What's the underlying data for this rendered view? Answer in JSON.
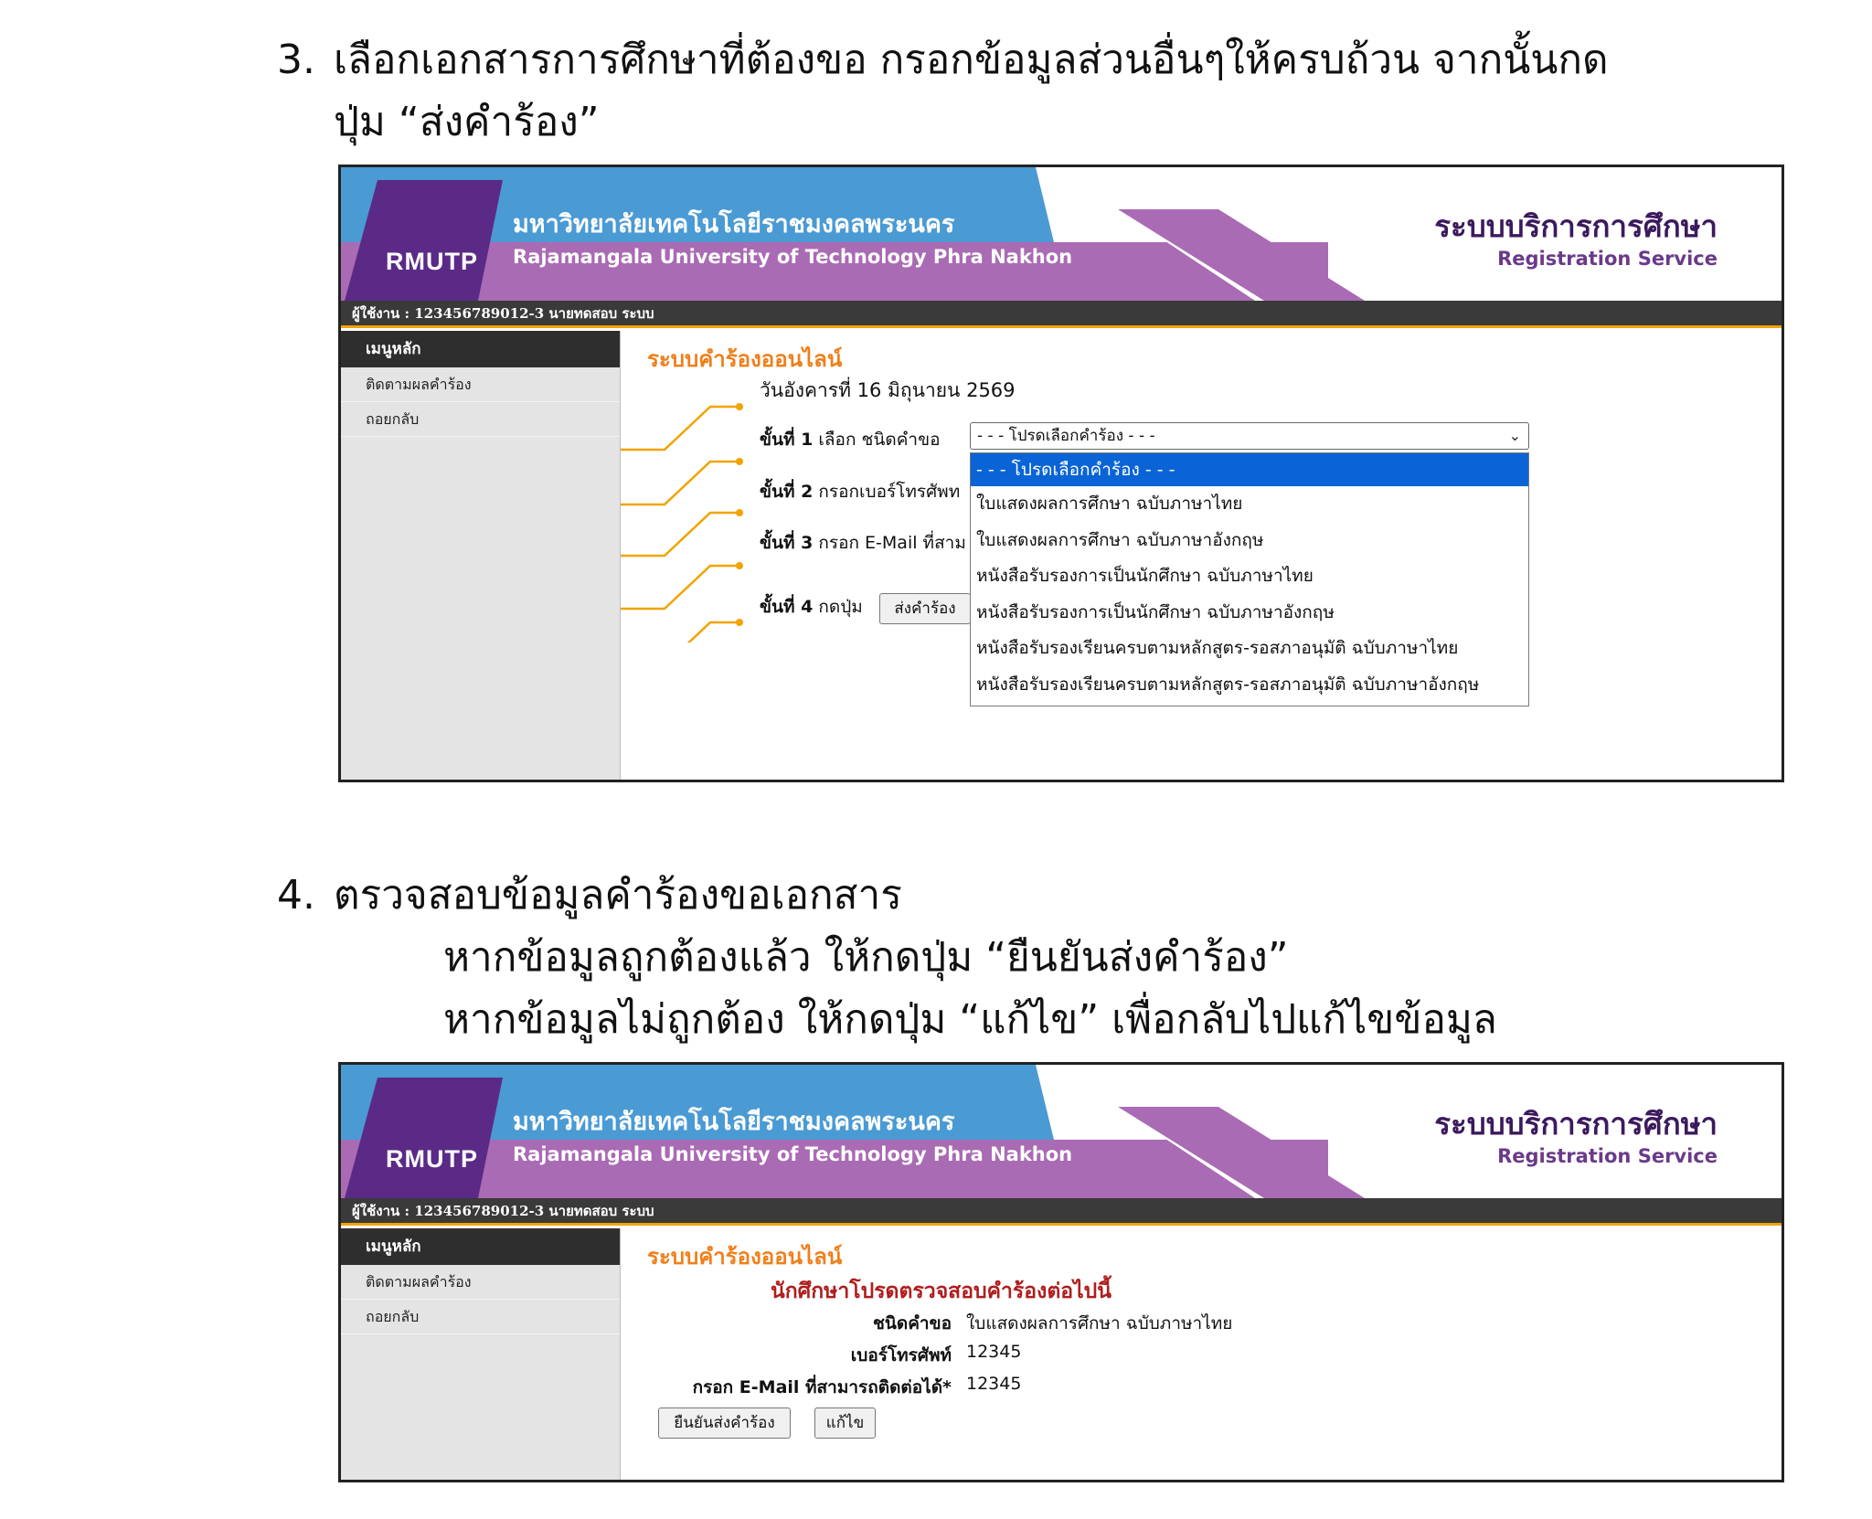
{
  "step3": {
    "number": "3.",
    "line1": "เลือกเอกสารการศึกษาที่ต้องขอ กรอกข้อมูลส่วนอื่นๆให้ครบถ้วน จากนั้นกด",
    "line2": "ปุ่ม “ส่งคำร้อง”"
  },
  "step4": {
    "number": "4.",
    "line1": "ตรวจสอบข้อมูลคำร้องขอเอกสาร",
    "line2": "หากข้อมูลถูกต้องแล้ว ให้กดปุ่ม “ยืนยันส่งคำร้อง”",
    "line3": "หากข้อมูลไม่ถูกต้อง ให้กดปุ่ม “แก้ไข” เพื่อกลับไปแก้ไขข้อมูล"
  },
  "header": {
    "logo_text": "RMUTP",
    "university_th": "มหาวิทยาลัยเทคโนโลยีราชมงคลพระนคร",
    "university_en": "Rajamangala University of Technology Phra Nakhon",
    "system_th": "ระบบบริการการศึกษา",
    "system_en": "Registration Service",
    "user_line": "ผู้ใช้งาน : 123456789012-3 นายทดสอบ ระบบ"
  },
  "sidebar": {
    "title": "เมนูหลัก",
    "items": [
      {
        "label": "ติดตามผลคำร้อง"
      },
      {
        "label": "ถอยกลับ"
      }
    ]
  },
  "form": {
    "content_title": "ระบบคำร้องออนไลน์",
    "date_text": "วันอังคารที่ 16 มิถุนายน 2569",
    "step1_label": "ขั้นที่ 1",
    "step1_text": "เลือก ชนิดคำขอ",
    "step2_label": "ขั้นที่ 2",
    "step2_text": "กรอกเบอร์โทรศัพท",
    "step3_label": "ขั้นที่ 3",
    "step3_text": "กรอก E-Mail ที่สาม",
    "step4_label": "ขั้นที่ 4",
    "step4_text": "กดปุ่ม",
    "submit_button": "ส่งคำร้อง",
    "select_value": "- - - โปรดเลือกคำร้อง - - -",
    "options": [
      "- - - โปรดเลือกคำร้อง - - -",
      "ใบแสดงผลการศึกษา ฉบับภาษาไทย",
      "ใบแสดงผลการศึกษา ฉบับภาษาอังกฤษ",
      "หนังสือรับรองการเป็นนักศึกษา ฉบับภาษาไทย",
      "หนังสือรับรองการเป็นนักศึกษา ฉบับภาษาอังกฤษ",
      "หนังสือรับรองเรียนครบตามหลักสูตร-รอสภาอนุมัติ ฉบับภาษาไทย",
      "หนังสือรับรองเรียนครบตามหลักสูตร-รอสภาอนุมัติ ฉบับภาษาอังกฤษ"
    ]
  },
  "confirm": {
    "content_title": "ระบบคำร้องออนไลน์",
    "heading": "นักศึกษาโปรดตรวจสอบคำร้องต่อไปนี้",
    "type_label": "ชนิดคำขอ",
    "type_value": "ใบแสดงผลการศึกษา ฉบับภาษาไทย",
    "phone_label": "เบอร์โทรศัพท์",
    "phone_value": "12345",
    "email_label": "กรอก E-Mail ที่สามารถติดต่อได้*",
    "email_value": "12345",
    "confirm_button": "ยืนยันส่งคำร้อง",
    "edit_button": "แก้ไข"
  },
  "colors": {
    "purple_dark": "#5b2a86",
    "purple_light": "#a96bb3",
    "blue_band": "#4a9ad4",
    "accent_orange": "#f07f1b",
    "select_blue": "#0a64d6"
  }
}
